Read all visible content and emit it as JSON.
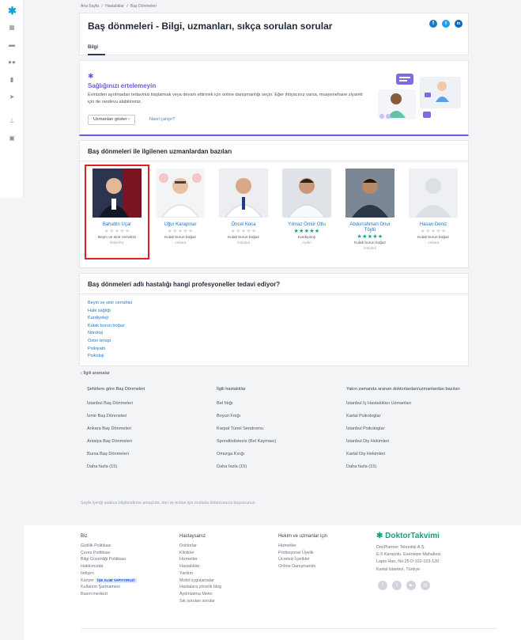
{
  "sidebar": {
    "logo": "✱",
    "nav_icons": [
      "calendar-icon",
      "chat-icon",
      "patients-icon",
      "stats-icon",
      "send-icon",
      "hierarchy-icon",
      "badge-icon"
    ]
  },
  "breadcrumb": [
    "Ana Sayfa",
    "/",
    "Hastalıklar",
    "/",
    "Baş Dönmeleri"
  ],
  "header": {
    "title": "Baş dönmeleri - Bilgi, uzmanları, sıkça sorulan sorular",
    "tab": "Bilgi",
    "share": {
      "facebook": "f",
      "twitter": "t",
      "linkedin": "in"
    }
  },
  "promo": {
    "title": "Sağlığınızı ertelemeyin",
    "text": "Evinizden ayrılmadan tedavinizi başlatmak veya devam ettirmek için online danışmanlığı seçin. Eğer ihtiyacınız varsa, muayenehane ziyareti için de randevu alabilirsiniz.",
    "button": "Uzmanları göster",
    "button_icon": "›",
    "link": "Nasıl çalışır?"
  },
  "specialists": {
    "title": "Baş dönmeleri ile ilgilenen uzmanlardan bazıları",
    "doctors": [
      {
        "name": "Bahattin Uçar",
        "stars": "★★★★★",
        "star_color": "#d1d5db",
        "specialty": "Beyin ve sinir cerrahisi",
        "city": "Bakırköy",
        "photo": "doctor-1"
      },
      {
        "name": "Uğur Karapınar",
        "stars": "★★★★★",
        "star_color": "#d1d5db",
        "specialty": "Kulak burun boğaz",
        "city": "Ankara",
        "photo": "doctor-2"
      },
      {
        "name": "Öncel Koca",
        "stars": "★★★★★",
        "star_color": "#d1d5db",
        "specialty": "Kulak burun boğaz",
        "city": "İstanbul",
        "photo": "doctor-3"
      },
      {
        "name": "Yılmaz Ömür Otlu",
        "stars": "★★★★★",
        "star_color": "#0fa47f",
        "specialty": "Kardiyoloji",
        "city": "Aydın",
        "photo": "doctor-4"
      },
      {
        "name": "Abdurrahman Onur Töylü",
        "stars": "★★★★★",
        "star_color": "#0fa47f",
        "specialty": "Kulak burun boğaz",
        "city": "İstanbul",
        "photo": "doctor-5"
      },
      {
        "name": "Hasan Deniz",
        "stars": "★★★★★",
        "star_color": "#d1d5db",
        "specialty": "Kulak burun boğaz",
        "city": "Ankara",
        "photo": "doctor-placeholder"
      }
    ]
  },
  "professionals": {
    "title": "Baş dönmeleri adlı hastalığı hangi profesyoneller tedavi ediyor?",
    "items": [
      "Beyin ve sinir cerrahisi",
      "Halk sağlığı",
      "Kardiyoloji",
      "Kulak burun boğaz",
      "Nöroloji",
      "Ozon terapi",
      "Psikiyatri",
      "Psikoloji"
    ]
  },
  "related": {
    "title": "İlgili aramalar",
    "columns": [
      {
        "head": "Şehirlere göre Baş Dönmeleri",
        "items": [
          "İstanbul Baş Dönmeleri",
          "İzmir Baş Dönmeleri",
          "Ankara Baş Dönmeleri",
          "Antalya Baş Dönmeleri",
          "Bursa Baş Dönmeleri",
          "Daha fazla (15)"
        ]
      },
      {
        "head": "İlgili hastalıklar",
        "items": [
          "Bel fıtığı",
          "Boyun Fıtığı",
          "Karpal Tünel Sendromu",
          "Spondilolistezis (Bel Kayması)",
          "Omurga Kırığı",
          "Daha fazla (15)"
        ]
      },
      {
        "head": "Yakın zamanda aranan doktorlardan/uzmanlardan bazıları",
        "items": [
          "İstanbul İç Hastalıkları Uzmanları",
          "Kartal Psikologlar",
          "İstanbul Psikologlar",
          "İstanbul Diş Hekimleri",
          "Kartal Diş Hekimleri",
          "Daha fazla (15)"
        ]
      }
    ]
  },
  "disclaimer": "Sayfa içeriği sadece bilgilendirme amaçlıdır, tanı ve tedavi için mutlaka doktorunuza başvurunuz.",
  "footer": {
    "col1": {
      "head": "Biz",
      "items": [
        "Gizlilik Politikası",
        "Çerez Politikası",
        "Bilgi Güvenliği Politikası",
        "Hakkımızda",
        "İletişim",
        "Kariyer",
        "Kullanım Şartnamesi",
        "Basın merkezi"
      ],
      "badge": "İŞE ALIM YAPIYORUZ!"
    },
    "col2": {
      "head": "Hastaysanız",
      "items": [
        "Doktorlar",
        "Klinikler",
        "Hizmetler",
        "Hastalıklar",
        "Yardım",
        "Mobil uygulamalar",
        "Hastalara yönelik blog",
        "Aydınlatma Metni",
        "Sık sorulan sorular"
      ]
    },
    "col3": {
      "head": "Hekim ve uzmanlar için",
      "items": [
        "Hizmetler",
        "Profesyonel Üyelik",
        "Ücretsiz İçerikler",
        "Online Danışmanlık"
      ]
    },
    "brand": "DoktorTakvimi",
    "address": [
      "DocPlanner Teknoloji A.Ş.",
      "E-5 Karayolu, Esentepe Mahallesi,",
      "Lapis Han, No:25 D:102-103-120",
      "Kartal İstanbul, Türkiye"
    ],
    "social": [
      "f",
      "t",
      "▶",
      "◎"
    ]
  }
}
